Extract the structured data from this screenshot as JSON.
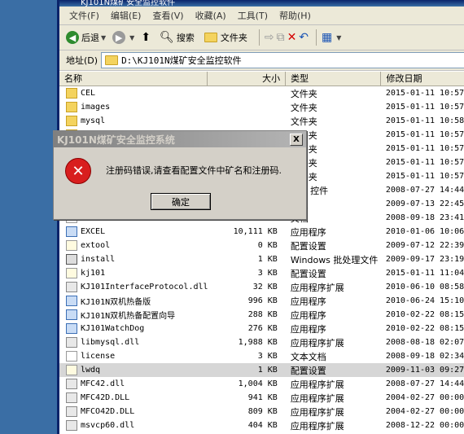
{
  "window": {
    "title": "KJ101N煤矿安全监控软件"
  },
  "menu": [
    "文件(F)",
    "编辑(E)",
    "查看(V)",
    "收藏(A)",
    "工具(T)",
    "帮助(H)"
  ],
  "toolbar": {
    "back": "后退",
    "search": "搜索",
    "folders": "文件夹"
  },
  "address": {
    "label": "地址(D)",
    "value": "D:\\KJ101N煤矿安全监控软件"
  },
  "columns": {
    "name": "名称",
    "size": "大小",
    "type": "类型",
    "date": "修改日期"
  },
  "files": [
    {
      "name": "CEL",
      "size": "",
      "type": "文件夹",
      "date": "2015-01-11 10:57",
      "icon": "folder"
    },
    {
      "name": "images",
      "size": "",
      "type": "文件夹",
      "date": "2015-01-11 10:57",
      "icon": "folder"
    },
    {
      "name": "mysql",
      "size": "",
      "type": "文件夹",
      "date": "2015-01-11 10:58",
      "icon": "folder"
    },
    {
      "name": "",
      "size": "",
      "type": "文件夹",
      "date": "2015-01-11 10:57",
      "icon": "folder"
    },
    {
      "name": "",
      "size": "",
      "type": "文件夹",
      "date": "2015-01-11 10:57",
      "icon": "folder"
    },
    {
      "name": "",
      "size": "",
      "type": "文件夹",
      "date": "2015-01-11 10:57",
      "icon": "folder"
    },
    {
      "name": "",
      "size": "",
      "type": "文件夹",
      "date": "2015-01-11 10:57",
      "icon": "folder"
    },
    {
      "name": "",
      "size": "",
      "type": "veX 控件",
      "date": "2008-07-27 14:44",
      "icon": "dll"
    },
    {
      "name": "",
      "size": "",
      "type": "设置",
      "date": "2009-07-13 22:45",
      "icon": "cfg"
    },
    {
      "name": "",
      "size": "",
      "type": "文档",
      "date": "2008-09-18 23:41",
      "icon": "txt"
    },
    {
      "name": "EXCEL",
      "size": "10,111 KB",
      "type": "应用程序",
      "date": "2010-01-06 10:06",
      "icon": "exe"
    },
    {
      "name": "extool",
      "size": "0 KB",
      "type": "配置设置",
      "date": "2009-07-12 22:39",
      "icon": "cfg"
    },
    {
      "name": "install",
      "size": "1 KB",
      "type": "Windows 批处理文件",
      "date": "2009-09-17 23:19",
      "icon": "bat"
    },
    {
      "name": "kj101",
      "size": "3 KB",
      "type": "配置设置",
      "date": "2015-01-11 11:04",
      "icon": "cfg"
    },
    {
      "name": "KJ101InterfaceProtocol.dll",
      "size": "32 KB",
      "type": "应用程序扩展",
      "date": "2010-06-10 08:58",
      "icon": "dll"
    },
    {
      "name": "KJ101N双机热备版",
      "size": "996 KB",
      "type": "应用程序",
      "date": "2010-06-24 15:10",
      "icon": "exe"
    },
    {
      "name": "KJ101N双机热备配置向导",
      "size": "288 KB",
      "type": "应用程序",
      "date": "2010-02-22 08:15",
      "icon": "exe"
    },
    {
      "name": "KJ101WatchDog",
      "size": "276 KB",
      "type": "应用程序",
      "date": "2010-02-22 08:15",
      "icon": "exe"
    },
    {
      "name": "libmysql.dll",
      "size": "1,988 KB",
      "type": "应用程序扩展",
      "date": "2008-08-18 02:07",
      "icon": "dll"
    },
    {
      "name": "license",
      "size": "3 KB",
      "type": "文本文档",
      "date": "2008-09-18 02:34",
      "icon": "txt"
    },
    {
      "name": "lwdq",
      "size": "1 KB",
      "type": "配置设置",
      "date": "2009-11-03 09:27",
      "icon": "cfg"
    },
    {
      "name": "MFC42.dll",
      "size": "1,004 KB",
      "type": "应用程序扩展",
      "date": "2008-07-27 14:44",
      "icon": "dll"
    },
    {
      "name": "MFC42D.DLL",
      "size": "941 KB",
      "type": "应用程序扩展",
      "date": "2004-02-27 00:00",
      "icon": "dll"
    },
    {
      "name": "MFCO42D.DLL",
      "size": "809 KB",
      "type": "应用程序扩展",
      "date": "2004-02-27 00:00",
      "icon": "dll"
    },
    {
      "name": "msvcp60.dll",
      "size": "404 KB",
      "type": "应用程序扩展",
      "date": "2008-12-22 00:00",
      "icon": "dll"
    }
  ],
  "dialog": {
    "title": "KJ101N煤矿安全监控系统",
    "close": "X",
    "icon_glyph": "✕",
    "message": "注册码错误,请查看配置文件中矿名和注册码.",
    "ok": "确定"
  }
}
